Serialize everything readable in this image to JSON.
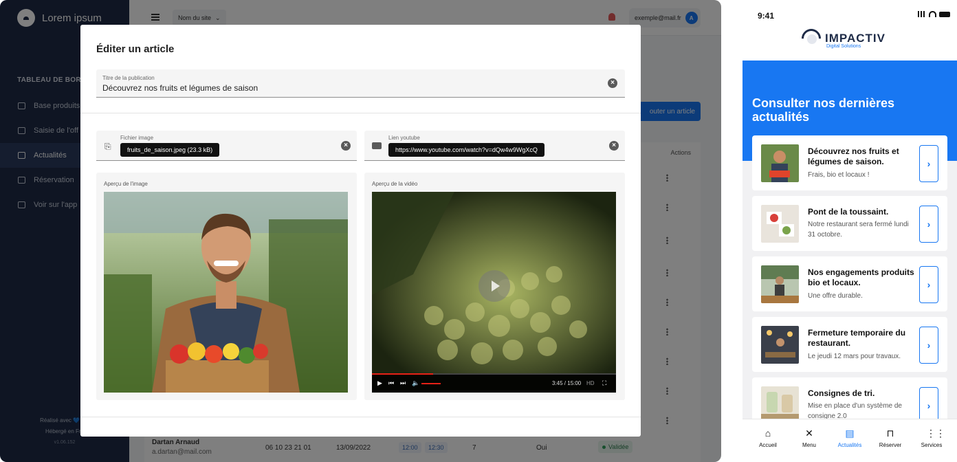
{
  "admin": {
    "brand": "Lorem ipsum",
    "sidebar_section": "TABLEAU DE BORD",
    "nav": [
      {
        "label": "Base produits"
      },
      {
        "label": "Saisie de l'off"
      },
      {
        "label": "Actualités"
      },
      {
        "label": "Réservation"
      },
      {
        "label": "Voir sur l'app"
      }
    ],
    "footer_line1": "Réalisé avec 💙 par",
    "footer_line2": "Hébergé en Fra",
    "footer_version": "v1.06.152",
    "site_select": "Nom du site",
    "user_email": "exemple@mail.fr",
    "user_initial": "A",
    "add_button": "outer un article",
    "actions_header": "Actions",
    "last_row": {
      "name": "Dartan Arnaud",
      "email": "a.dartan@mail.com",
      "phone": "06 10 23 21 01",
      "date": "13/09/2022",
      "time_start": "12:00",
      "time_end": "12:30",
      "people": "7",
      "answer": "Oui",
      "status": "Validée"
    }
  },
  "modal": {
    "title": "Éditer un article",
    "pub_title_label": "Titre de la publication",
    "pub_title_value": "Découvrez nos fruits et légumes de saison",
    "image_label": "Fichier image",
    "image_chip": "fruits_de_saison.jpeg (23.3 kB)",
    "youtube_label": "Lien youtube",
    "youtube_chip": "https://www.youtube.com/watch?v=dQw4w9WgXcQ",
    "image_preview_label": "Aperçu de l'image",
    "video_preview_label": "Aperçu de la vidéo",
    "video_time": "3:45 / 15:00",
    "video_quality": "HD",
    "video_progress_fraction": 0.25
  },
  "phone": {
    "time": "9:41",
    "logo_text": "IMPACTIV",
    "logo_sub": "Digital Solutions",
    "hero_title": "Consulter nos dernières actualités",
    "news": [
      {
        "title": "Découvrez nos fruits et légumes de saison.",
        "subtitle": "Frais, bio et locaux !"
      },
      {
        "title": "Pont de la toussaint.",
        "subtitle": "Notre restaurant sera fermé lundi 31 octobre."
      },
      {
        "title": "Nos engagements produits bio et locaux.",
        "subtitle": "Une offre durable."
      },
      {
        "title": "Fermeture temporaire du restaurant.",
        "subtitle": "Le jeudi 12 mars pour travaux."
      },
      {
        "title": "Consignes de tri.",
        "subtitle": "Mise en place d'un système de consigne 2.0"
      }
    ],
    "tabs": [
      {
        "label": "Accueil",
        "icon": "home-icon"
      },
      {
        "label": "Menu",
        "icon": "utensils-icon"
      },
      {
        "label": "Actualités",
        "icon": "newspaper-icon"
      },
      {
        "label": "Réserver",
        "icon": "table-icon"
      },
      {
        "label": "Services",
        "icon": "grid-icon"
      }
    ],
    "active_tab": "Actualités",
    "accent_color": "#1877f2"
  }
}
